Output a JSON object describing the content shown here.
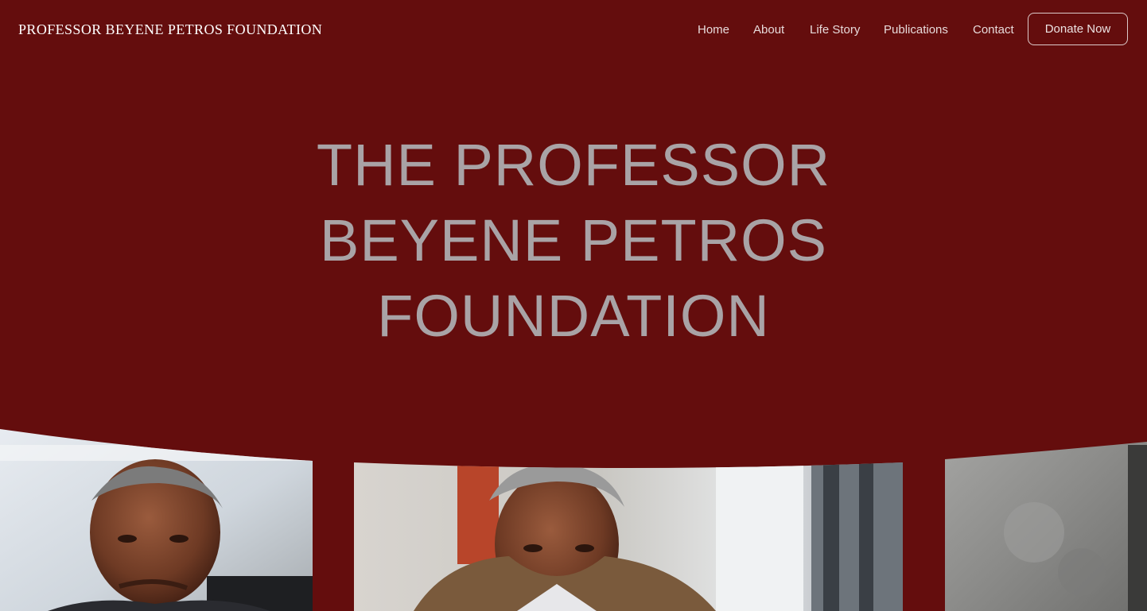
{
  "header": {
    "site_title": "PROFESSOR BEYENE PETROS FOUNDATION",
    "nav": {
      "home": "Home",
      "about": "About",
      "life_story": "Life Story",
      "publications": "Publications",
      "contact": "Contact"
    },
    "donate_label": "Donate Now"
  },
  "hero": {
    "title_lines": [
      "THE PROFESSOR",
      "BEYENE PETROS",
      "FOUNDATION"
    ]
  },
  "colors": {
    "background": "#640d0d",
    "hero_text": "#a9a3a6",
    "nav_text": "#e7dada"
  }
}
